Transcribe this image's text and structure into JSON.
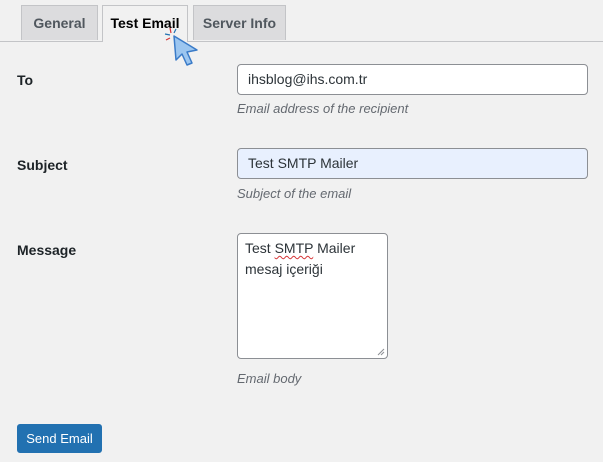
{
  "tabs": [
    {
      "label": "General",
      "active": false
    },
    {
      "label": "Test Email",
      "active": true
    },
    {
      "label": "Server Info",
      "active": false
    }
  ],
  "form": {
    "to": {
      "label": "To",
      "value": "ihsblog@ihs.com.tr",
      "description": "Email address of the recipient"
    },
    "subject": {
      "label": "Subject",
      "value": "Test SMTP Mailer",
      "description": "Subject of the email"
    },
    "message": {
      "label": "Message",
      "line1_before": "Test ",
      "line1_misspelled": "SMTP",
      "line1_after": " Mailer",
      "line2": "mesaj içeriği",
      "description": "Email body"
    }
  },
  "send_button": {
    "label": "Send Email"
  },
  "colors": {
    "accent": "#2271b1",
    "background": "#f1f1f1",
    "autofill": "#e8f0fe",
    "cursor": "#7cb3ea"
  }
}
